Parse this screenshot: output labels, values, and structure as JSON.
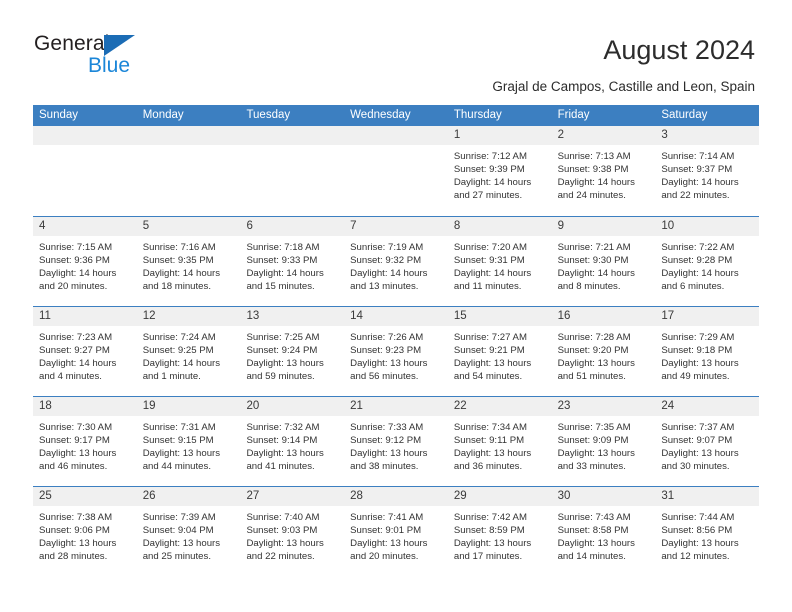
{
  "brand": {
    "name_top": "General",
    "name_bottom": "Blue",
    "triangle_icon": "blue-triangle-icon",
    "accent_color": "#1b6cb5",
    "blue_text_color": "#1b86d8"
  },
  "header": {
    "title": "August 2024",
    "subtitle": "Grajal de Campos, Castille and Leon, Spain"
  },
  "calendar": {
    "header_bg": "#3c7fc1",
    "day_band_bg": "#f0f0f0",
    "weekdays": [
      "Sunday",
      "Monday",
      "Tuesday",
      "Wednesday",
      "Thursday",
      "Friday",
      "Saturday"
    ],
    "weeks": [
      [
        {
          "day": "",
          "empty": true
        },
        {
          "day": "",
          "empty": true
        },
        {
          "day": "",
          "empty": true
        },
        {
          "day": "",
          "empty": true
        },
        {
          "day": "1",
          "sunrise": "Sunrise: 7:12 AM",
          "sunset": "Sunset: 9:39 PM",
          "daylight": "Daylight: 14 hours and 27 minutes."
        },
        {
          "day": "2",
          "sunrise": "Sunrise: 7:13 AM",
          "sunset": "Sunset: 9:38 PM",
          "daylight": "Daylight: 14 hours and 24 minutes."
        },
        {
          "day": "3",
          "sunrise": "Sunrise: 7:14 AM",
          "sunset": "Sunset: 9:37 PM",
          "daylight": "Daylight: 14 hours and 22 minutes."
        }
      ],
      [
        {
          "day": "4",
          "sunrise": "Sunrise: 7:15 AM",
          "sunset": "Sunset: 9:36 PM",
          "daylight": "Daylight: 14 hours and 20 minutes."
        },
        {
          "day": "5",
          "sunrise": "Sunrise: 7:16 AM",
          "sunset": "Sunset: 9:35 PM",
          "daylight": "Daylight: 14 hours and 18 minutes."
        },
        {
          "day": "6",
          "sunrise": "Sunrise: 7:18 AM",
          "sunset": "Sunset: 9:33 PM",
          "daylight": "Daylight: 14 hours and 15 minutes."
        },
        {
          "day": "7",
          "sunrise": "Sunrise: 7:19 AM",
          "sunset": "Sunset: 9:32 PM",
          "daylight": "Daylight: 14 hours and 13 minutes."
        },
        {
          "day": "8",
          "sunrise": "Sunrise: 7:20 AM",
          "sunset": "Sunset: 9:31 PM",
          "daylight": "Daylight: 14 hours and 11 minutes."
        },
        {
          "day": "9",
          "sunrise": "Sunrise: 7:21 AM",
          "sunset": "Sunset: 9:30 PM",
          "daylight": "Daylight: 14 hours and 8 minutes."
        },
        {
          "day": "10",
          "sunrise": "Sunrise: 7:22 AM",
          "sunset": "Sunset: 9:28 PM",
          "daylight": "Daylight: 14 hours and 6 minutes."
        }
      ],
      [
        {
          "day": "11",
          "sunrise": "Sunrise: 7:23 AM",
          "sunset": "Sunset: 9:27 PM",
          "daylight": "Daylight: 14 hours and 4 minutes."
        },
        {
          "day": "12",
          "sunrise": "Sunrise: 7:24 AM",
          "sunset": "Sunset: 9:25 PM",
          "daylight": "Daylight: 14 hours and 1 minute."
        },
        {
          "day": "13",
          "sunrise": "Sunrise: 7:25 AM",
          "sunset": "Sunset: 9:24 PM",
          "daylight": "Daylight: 13 hours and 59 minutes."
        },
        {
          "day": "14",
          "sunrise": "Sunrise: 7:26 AM",
          "sunset": "Sunset: 9:23 PM",
          "daylight": "Daylight: 13 hours and 56 minutes."
        },
        {
          "day": "15",
          "sunrise": "Sunrise: 7:27 AM",
          "sunset": "Sunset: 9:21 PM",
          "daylight": "Daylight: 13 hours and 54 minutes."
        },
        {
          "day": "16",
          "sunrise": "Sunrise: 7:28 AM",
          "sunset": "Sunset: 9:20 PM",
          "daylight": "Daylight: 13 hours and 51 minutes."
        },
        {
          "day": "17",
          "sunrise": "Sunrise: 7:29 AM",
          "sunset": "Sunset: 9:18 PM",
          "daylight": "Daylight: 13 hours and 49 minutes."
        }
      ],
      [
        {
          "day": "18",
          "sunrise": "Sunrise: 7:30 AM",
          "sunset": "Sunset: 9:17 PM",
          "daylight": "Daylight: 13 hours and 46 minutes."
        },
        {
          "day": "19",
          "sunrise": "Sunrise: 7:31 AM",
          "sunset": "Sunset: 9:15 PM",
          "daylight": "Daylight: 13 hours and 44 minutes."
        },
        {
          "day": "20",
          "sunrise": "Sunrise: 7:32 AM",
          "sunset": "Sunset: 9:14 PM",
          "daylight": "Daylight: 13 hours and 41 minutes."
        },
        {
          "day": "21",
          "sunrise": "Sunrise: 7:33 AM",
          "sunset": "Sunset: 9:12 PM",
          "daylight": "Daylight: 13 hours and 38 minutes."
        },
        {
          "day": "22",
          "sunrise": "Sunrise: 7:34 AM",
          "sunset": "Sunset: 9:11 PM",
          "daylight": "Daylight: 13 hours and 36 minutes."
        },
        {
          "day": "23",
          "sunrise": "Sunrise: 7:35 AM",
          "sunset": "Sunset: 9:09 PM",
          "daylight": "Daylight: 13 hours and 33 minutes."
        },
        {
          "day": "24",
          "sunrise": "Sunrise: 7:37 AM",
          "sunset": "Sunset: 9:07 PM",
          "daylight": "Daylight: 13 hours and 30 minutes."
        }
      ],
      [
        {
          "day": "25",
          "sunrise": "Sunrise: 7:38 AM",
          "sunset": "Sunset: 9:06 PM",
          "daylight": "Daylight: 13 hours and 28 minutes."
        },
        {
          "day": "26",
          "sunrise": "Sunrise: 7:39 AM",
          "sunset": "Sunset: 9:04 PM",
          "daylight": "Daylight: 13 hours and 25 minutes."
        },
        {
          "day": "27",
          "sunrise": "Sunrise: 7:40 AM",
          "sunset": "Sunset: 9:03 PM",
          "daylight": "Daylight: 13 hours and 22 minutes."
        },
        {
          "day": "28",
          "sunrise": "Sunrise: 7:41 AM",
          "sunset": "Sunset: 9:01 PM",
          "daylight": "Daylight: 13 hours and 20 minutes."
        },
        {
          "day": "29",
          "sunrise": "Sunrise: 7:42 AM",
          "sunset": "Sunset: 8:59 PM",
          "daylight": "Daylight: 13 hours and 17 minutes."
        },
        {
          "day": "30",
          "sunrise": "Sunrise: 7:43 AM",
          "sunset": "Sunset: 8:58 PM",
          "daylight": "Daylight: 13 hours and 14 minutes."
        },
        {
          "day": "31",
          "sunrise": "Sunrise: 7:44 AM",
          "sunset": "Sunset: 8:56 PM",
          "daylight": "Daylight: 13 hours and 12 minutes."
        }
      ]
    ]
  }
}
